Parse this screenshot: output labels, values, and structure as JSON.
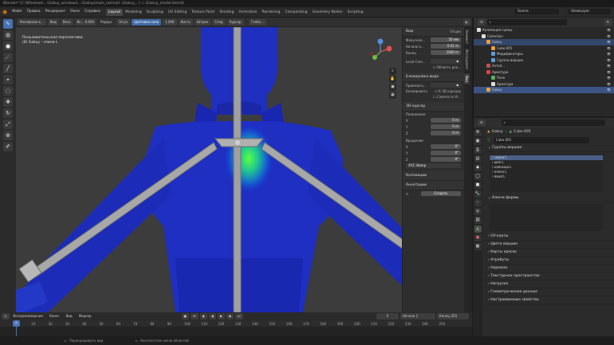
{
  "window": {
    "title": "Blender* [C:\\Windows\\...\\Gakuy_windows\\...\\Gakuy\\main_normal\\..\\Gakuy_..\\..\\..\\Gakuy_model.blend]"
  },
  "menubar": {
    "items": [
      "Файл",
      "Правка",
      "Рендеринг",
      "Окно",
      "Справка"
    ],
    "tabs": [
      "Layout",
      "Modeling",
      "Sculpting",
      "UV Editing",
      "Texture Paint",
      "Shading",
      "Animation",
      "Rendering",
      "Compositing",
      "Geometry Nodes",
      "Scripting"
    ],
    "active_tab": "Layout",
    "scene_label": "Scene",
    "viewlayer_label": "ViewLayer"
  },
  "viewport_header": {
    "mode": "Рисование в...",
    "view": "Вид",
    "weights": "Веса",
    "brush": "Вс... 0.600",
    "radius_label": "Радиус",
    "radius_value": "10 px",
    "strength_label": "Цветовая сила",
    "strength_value": "1.000",
    "brush_menu": "Кисть",
    "stroke_menu": "Штрих",
    "falloff_menu": "Спад",
    "cursor_menu": "Курсор",
    "transform_menu": "Глоба..."
  },
  "overlay": {
    "line1": "Пользовательская перспектива",
    "line2": "(0) Gakuy - спина L"
  },
  "npanel": {
    "view_title": "Вид",
    "options_label": "Опции",
    "focal_label": "Фокусное...",
    "focal_value": "50 мм",
    "clip_start_label": "Начало о...",
    "clip_start_value": "0.01 m",
    "clip_end_label": "Конец",
    "clip_end_value": "1000 m",
    "local_cam_label": "Local Cam...",
    "region_label": "Область рен...",
    "lock_title": "Блокировка вида",
    "lock_to_object_label": "Привязать...",
    "lock_label": "Блокировать",
    "lock_3d_cursor": "К 3D курсору",
    "lock_camera": "Camera to Vi...",
    "cursor_title": "3D-курсор",
    "location_label": "Положение:",
    "loc_x": "0 m",
    "loc_y": "0 m",
    "loc_z": "0 m",
    "rotation_label": "Вращение:",
    "rot_x": "0°",
    "rot_y": "0°",
    "rot_z": "0°",
    "rot_mode": "XYZ Эйлер",
    "collections_title": "Коллекции",
    "annotations_title": "Аннотации",
    "new_button": "Создать",
    "vtabs": [
      "Элемент",
      "Инструмент",
      "Вид"
    ]
  },
  "timeline": {
    "playback": "Воспроизведение",
    "keying": "Кеинг",
    "view": "Вид",
    "marker": "Маркер",
    "current_frame": "0",
    "start_label": "Начало",
    "start_value": "1",
    "end_label": "Конец",
    "end_value": "250",
    "frames": [
      "0",
      "10",
      "20",
      "30",
      "40",
      "50",
      "60",
      "70",
      "80",
      "90",
      "100",
      "110",
      "120",
      "130",
      "140",
      "150",
      "160",
      "170",
      "180",
      "190",
      "200",
      "210",
      "220",
      "230",
      "240",
      "250"
    ]
  },
  "statusbar": {
    "hint1": "Перекрашивать вид",
    "hint2": "Контекстное меню областей"
  },
  "outliner": {
    "rows": [
      {
        "label": "Коллекция сцены",
        "indent": 0,
        "state": "",
        "icon_color": "#dddddd"
      },
      {
        "label": "Collection",
        "indent": 1,
        "state": "",
        "icon_color": "#dddddd"
      },
      {
        "label": "Gakuy",
        "indent": 2,
        "state": "sel",
        "icon_color": "#e8a040"
      },
      {
        "label": "Cube.005",
        "indent": 3,
        "state": "",
        "icon_color": "#e8a040"
      },
      {
        "label": "Модификаторы",
        "indent": 3,
        "state": "",
        "icon_color": "#5a9fd6"
      },
      {
        "label": "Группы вершин",
        "indent": 3,
        "state": "",
        "icon_color": "#5a9fd6"
      },
      {
        "label": "Armat...",
        "indent": 2,
        "state": "",
        "icon_color": "#c05050"
      },
      {
        "label": "Арматура",
        "indent": 2,
        "state": "",
        "icon_color": "#dd4444"
      },
      {
        "label": "Поза",
        "indent": 3,
        "state": "",
        "icon_color": "#5ab05a"
      },
      {
        "label": "Арматура",
        "indent": 3,
        "state": "",
        "icon_color": "#dddddd"
      },
      {
        "label": "Gakuy",
        "indent": 2,
        "state": "active",
        "icon_color": "#e8a040"
      }
    ]
  },
  "properties": {
    "object_name": "Gakuy",
    "mesh_name": "Cube.005",
    "data_name": "Cube.005",
    "vertex_groups_title": "Группы вершин",
    "vertex_groups": [
      {
        "name": "спина L",
        "selected": true
      },
      {
        "name": "шея L",
        "selected": false
      },
      {
        "name": "ключица L",
        "selected": false
      },
      {
        "name": "плечо L",
        "selected": false
      },
      {
        "name": "Head L",
        "selected": false
      }
    ],
    "shape_keys_title": "Ключи формы",
    "sections": [
      "UV-карты",
      "Цвета вершин",
      "Карты красок",
      "Атрибуты",
      "Нормали",
      "Текстурное пространство",
      "Нагрузка",
      "Геометрические данные",
      "Настраиваемые свойства"
    ]
  }
}
